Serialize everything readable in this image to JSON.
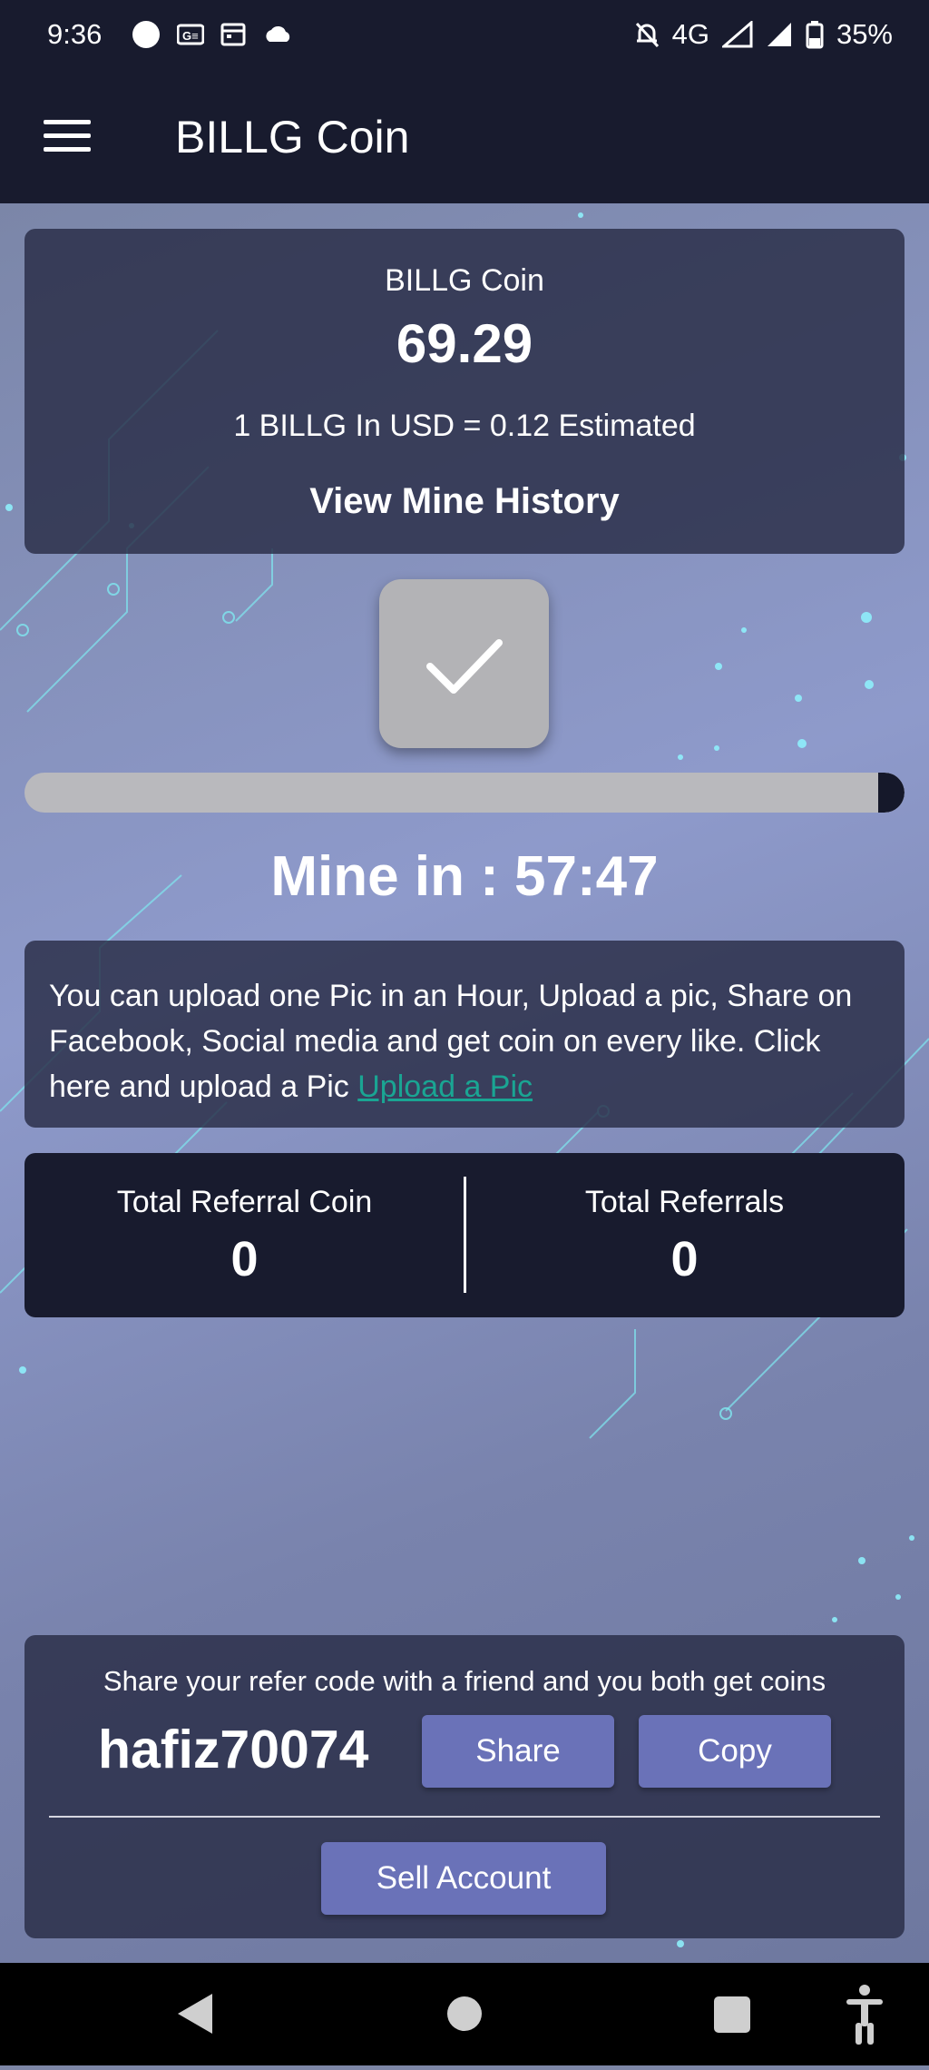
{
  "status_bar": {
    "time": "9:36",
    "network": "4G",
    "battery": "35%"
  },
  "app_bar": {
    "title": "BILLG Coin"
  },
  "balance_card": {
    "title": "BILLG Coin",
    "value": "69.29",
    "rate": "1 BILLG In USD = 0.12 Estimated",
    "history_link": "View Mine History"
  },
  "mining": {
    "progress_percent": 97,
    "countdown": "Mine in : 57:47"
  },
  "upload_info": {
    "text": "You can upload one Pic in an Hour, Upload a pic, Share on Facebook, Social media and get coin on every like. Click here and upload a Pic ",
    "link": "Upload a Pic"
  },
  "referral_stats": {
    "coin_label": "Total Referral Coin",
    "coin_value": "0",
    "count_label": "Total Referrals",
    "count_value": "0"
  },
  "refer_card": {
    "text": "Share your refer code with a friend and you both get coins",
    "code": "hafiz70074",
    "share_label": "Share",
    "copy_label": "Copy",
    "sell_label": "Sell Account"
  },
  "colors": {
    "bar_bg": "#181b2e",
    "card_bg": "#282c46",
    "button": "#6a72b8",
    "link": "#1aa593"
  }
}
